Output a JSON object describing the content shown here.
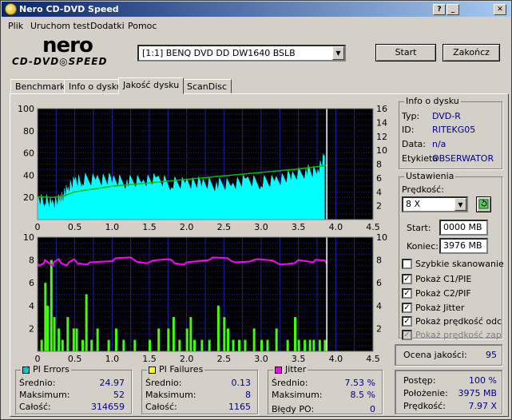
{
  "window": {
    "title": "Nero CD-DVD Speed"
  },
  "menu": [
    "Plik",
    "Uruchom test",
    "Dodatki",
    "Pomoc"
  ],
  "logo": {
    "brand": "nero",
    "subtitle": "CD-DVD◎SPEED"
  },
  "drive": {
    "selected": "[1:1]  BENQ DVD DD DW1640 BSLB"
  },
  "buttons": {
    "start": "Start",
    "end": "Zakończ"
  },
  "tabs": [
    "Benchmark",
    "Info o dysku",
    "Jakość dysku",
    "ScanDisc"
  ],
  "active_tab": 2,
  "disc_info": {
    "title": "Info o dysku",
    "rows": [
      {
        "label": "Typ:",
        "value": "DVD-R"
      },
      {
        "label": "ID:",
        "value": "RITEKG05"
      },
      {
        "label": "Data:",
        "value": "n/a"
      },
      {
        "label": "Etykieta",
        "value": "OBSERWATOR"
      }
    ]
  },
  "settings": {
    "title": "Ustawienia",
    "speed_label": "Prędkość:",
    "speed_value": "8 X",
    "start_label": "Start:",
    "start_value": "0000 MB",
    "end_label": "Koniec:",
    "end_value": "3976 MB",
    "checkboxes": [
      {
        "label": "Szybkie skanowanie",
        "checked": false,
        "enabled": true
      },
      {
        "label": "Pokaż C1/PIE",
        "checked": true,
        "enabled": true
      },
      {
        "label": "Pokaż C2/PIF",
        "checked": true,
        "enabled": true
      },
      {
        "label": "Pokaż Jitter",
        "checked": true,
        "enabled": true
      },
      {
        "label": "Pokaż prędkość odczy",
        "checked": true,
        "enabled": true
      },
      {
        "label": "Pokaż prędkość zapisu",
        "checked": true,
        "enabled": false
      }
    ]
  },
  "quality": {
    "label": "Ocena jakości:",
    "value": "95"
  },
  "pi_errors": {
    "title": "PI Errors",
    "color": "#00c8c8",
    "avg_label": "Średnio:",
    "avg": "24.97",
    "max_label": "Maksimum:",
    "max": "52",
    "total_label": "Całość:",
    "total": "314659"
  },
  "pi_failures": {
    "title": "PI Failures",
    "color": "#ffff00",
    "avg_label": "Średnio:",
    "avg": "0.13",
    "max_label": "Maksimum:",
    "max": "8",
    "total_label": "Całość:",
    "total": "1165"
  },
  "jitter": {
    "title": "Jitter",
    "color": "#ff00ff",
    "avg_label": "Średnio:",
    "avg": "7.53 %",
    "max_label": "Maksimum:",
    "max": "8.5 %",
    "po_label": "Błędy PO:",
    "po": "0"
  },
  "progress": {
    "postep_label": "Postęp:",
    "postep": "100 %",
    "polozenie_label": "Położenie:",
    "polozenie": "3975 MB",
    "predkosc_label": "Prędkość:",
    "predkosc": "7.97 X"
  },
  "chart_data": [
    {
      "type": "area",
      "x_ticks": [
        "0",
        "0.5",
        "1.0",
        "1.5",
        "2.0",
        "2.5",
        "3.0",
        "3.5",
        "4.0",
        "4.5"
      ],
      "xlim": [
        0,
        4.5
      ],
      "ylim_left": [
        0,
        100
      ],
      "y_ticks_left": [
        "20",
        "40",
        "60",
        "80",
        "100"
      ],
      "ylim_right": [
        0,
        16
      ],
      "y_ticks_right": [
        "2",
        "4",
        "6",
        "8",
        "10",
        "12",
        "14",
        "16"
      ],
      "end_marker_x": 3.88,
      "series": [
        {
          "color": "#00ffff",
          "kind": "area",
          "points": [
            [
              0.0,
              16
            ],
            [
              0.1,
              17
            ],
            [
              0.2,
              15
            ],
            [
              0.3,
              17
            ],
            [
              0.35,
              20
            ],
            [
              0.4,
              29
            ],
            [
              0.5,
              33
            ],
            [
              0.6,
              35
            ],
            [
              0.8,
              37
            ],
            [
              1.0,
              35
            ],
            [
              1.2,
              33
            ],
            [
              1.4,
              36
            ],
            [
              1.6,
              35
            ],
            [
              1.8,
              32
            ],
            [
              2.0,
              34
            ],
            [
              2.2,
              32
            ],
            [
              2.4,
              31
            ],
            [
              2.6,
              33
            ],
            [
              2.8,
              34
            ],
            [
              3.0,
              33
            ],
            [
              3.2,
              36
            ],
            [
              3.4,
              38
            ],
            [
              3.6,
              43
            ],
            [
              3.75,
              44
            ],
            [
              3.85,
              55
            ]
          ]
        },
        {
          "color": "#00c000",
          "kind": "line",
          "axis": "right",
          "points": [
            [
              0.0,
              3.3
            ],
            [
              0.2,
              3.2
            ],
            [
              0.35,
              3.4
            ],
            [
              0.5,
              4.0
            ],
            [
              1.0,
              4.8
            ],
            [
              1.5,
              5.3
            ],
            [
              2.0,
              5.8
            ],
            [
              2.5,
              6.3
            ],
            [
              3.0,
              6.8
            ],
            [
              3.5,
              7.3
            ],
            [
              3.88,
              7.8
            ]
          ]
        }
      ]
    },
    {
      "type": "bar",
      "x_ticks": [
        "0",
        "0.5",
        "1.0",
        "1.5",
        "2.0",
        "2.5",
        "3.0",
        "3.5",
        "4.0",
        "4.5"
      ],
      "xlim": [
        0,
        4.5
      ],
      "ylim_left": [
        0,
        10
      ],
      "y_ticks_left": [
        "2",
        "4",
        "6",
        "8",
        "10"
      ],
      "ylim_right": [
        0,
        10
      ],
      "y_ticks_right": [
        "2",
        "4",
        "6",
        "8",
        "10"
      ],
      "end_marker_x": 3.88,
      "series": [
        {
          "color": "#40ff00",
          "kind": "bars",
          "points": [
            [
              0.05,
              1
            ],
            [
              0.1,
              6
            ],
            [
              0.13,
              4
            ],
            [
              0.18,
              8
            ],
            [
              0.22,
              3
            ],
            [
              0.28,
              2
            ],
            [
              0.33,
              1
            ],
            [
              0.4,
              3
            ],
            [
              0.48,
              2
            ],
            [
              0.52,
              2
            ],
            [
              0.6,
              1
            ],
            [
              0.65,
              5
            ],
            [
              0.72,
              1
            ],
            [
              0.8,
              2
            ],
            [
              0.95,
              1
            ],
            [
              1.05,
              2
            ],
            [
              1.15,
              1
            ],
            [
              1.3,
              1
            ],
            [
              1.5,
              1
            ],
            [
              1.62,
              2
            ],
            [
              1.75,
              2
            ],
            [
              1.82,
              3
            ],
            [
              1.9,
              1
            ],
            [
              2.0,
              2
            ],
            [
              2.05,
              3
            ],
            [
              2.1,
              1
            ],
            [
              2.2,
              1
            ],
            [
              2.3,
              1
            ],
            [
              2.42,
              4
            ],
            [
              2.5,
              3
            ],
            [
              2.55,
              2
            ],
            [
              2.62,
              1
            ],
            [
              2.7,
              1
            ],
            [
              2.78,
              1
            ],
            [
              2.9,
              2
            ],
            [
              3.0,
              1
            ],
            [
              3.08,
              1
            ],
            [
              3.2,
              2
            ],
            [
              3.35,
              1
            ],
            [
              3.45,
              3
            ],
            [
              3.5,
              1
            ],
            [
              3.58,
              1
            ],
            [
              3.65,
              1
            ],
            [
              3.7,
              1
            ],
            [
              3.78,
              1
            ],
            [
              3.85,
              1
            ]
          ]
        },
        {
          "color": "#ff00ff",
          "kind": "line",
          "points": [
            [
              0.0,
              7.7
            ],
            [
              0.1,
              8.0
            ],
            [
              0.2,
              7.5
            ],
            [
              0.3,
              7.9
            ],
            [
              0.4,
              7.6
            ],
            [
              0.5,
              8.0
            ],
            [
              0.7,
              7.8
            ],
            [
              1.0,
              7.9
            ],
            [
              1.3,
              8.0
            ],
            [
              1.5,
              7.8
            ],
            [
              1.8,
              8.0
            ],
            [
              2.0,
              7.8
            ],
            [
              2.3,
              8.0
            ],
            [
              2.6,
              7.9
            ],
            [
              2.9,
              8.0
            ],
            [
              3.2,
              7.8
            ],
            [
              3.5,
              8.0
            ],
            [
              3.7,
              7.8
            ],
            [
              3.88,
              7.7
            ]
          ]
        }
      ]
    }
  ]
}
